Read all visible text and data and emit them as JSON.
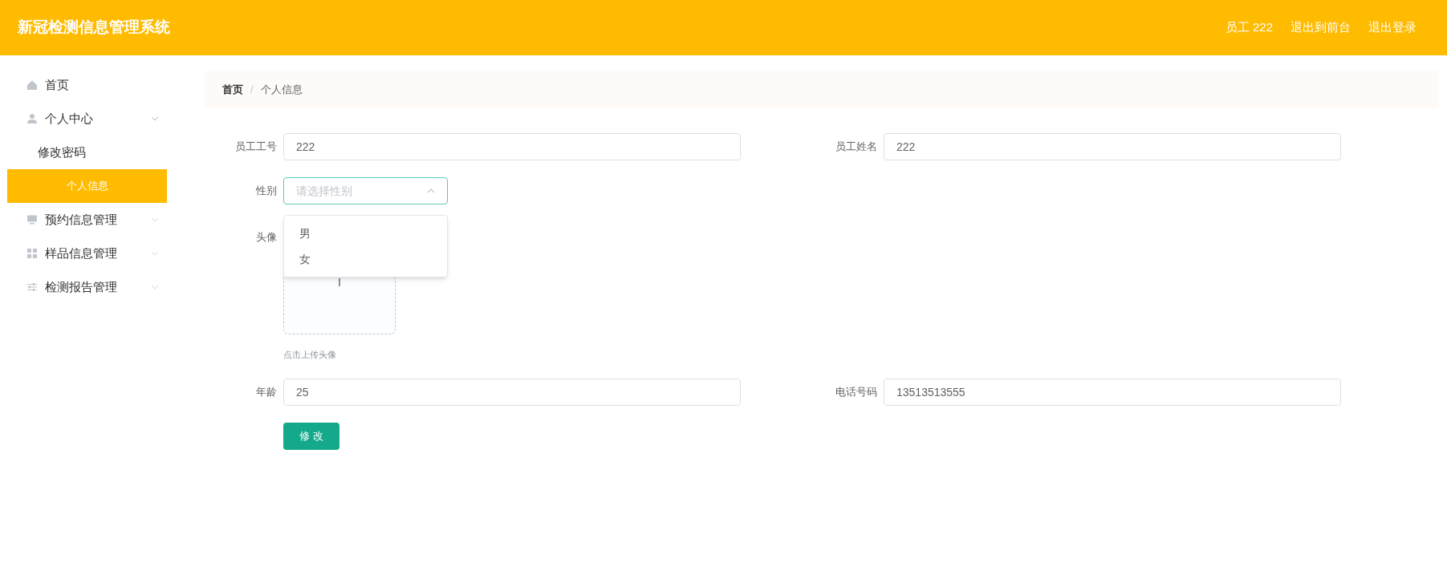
{
  "header": {
    "title": "新冠检测信息管理系统",
    "user": "员工 222",
    "links": [
      "退出到前台",
      "退出登录"
    ]
  },
  "sidebar": {
    "items": [
      {
        "label": "首页",
        "selected": false
      },
      {
        "label": "个人中心",
        "selected": false,
        "expanded": true,
        "children": [
          {
            "label": "修改密码",
            "selected": false
          },
          {
            "label": "个人信息",
            "selected": true
          }
        ]
      },
      {
        "label": "预约信息管理",
        "selected": false,
        "expanded": false
      },
      {
        "label": "样品信息管理",
        "selected": false,
        "expanded": false
      },
      {
        "label": "检测报告管理",
        "selected": false,
        "expanded": false
      }
    ]
  },
  "breadcrumb": {
    "separator": "/",
    "items": [
      "首页",
      "个人信息"
    ]
  },
  "form": {
    "employee_no": {
      "label": "员工工号",
      "value": "222"
    },
    "employee_name": {
      "label": "员工姓名",
      "value": "222"
    },
    "gender": {
      "label": "性别",
      "placeholder": "请选择性别",
      "expanded": true,
      "options": [
        "男",
        "女"
      ]
    },
    "avatar": {
      "label": "头像",
      "hint": "点击上传头像"
    },
    "age": {
      "label": "年龄",
      "value": "25"
    },
    "phone": {
      "label": "电话号码",
      "value": "13513513555"
    },
    "submit": "修 改"
  }
}
